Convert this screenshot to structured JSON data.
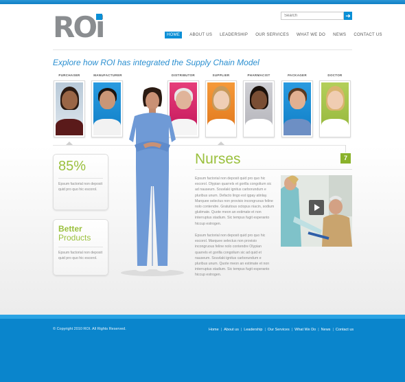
{
  "brand": {
    "logo_text": "ROi"
  },
  "search": {
    "placeholder": "Search",
    "go_icon": "arrow-right-icon"
  },
  "nav": {
    "items": [
      {
        "label": "HOME",
        "active": true
      },
      {
        "label": "ABOUT US",
        "active": false
      },
      {
        "label": "LEADERSHIP",
        "active": false
      },
      {
        "label": "OUR SERVICES",
        "active": false
      },
      {
        "label": "WHAT WE DO",
        "active": false
      },
      {
        "label": "NEWS",
        "active": false
      },
      {
        "label": "CONTACT US",
        "active": false
      }
    ]
  },
  "hero": {
    "tagline": "Explore how ROI has integrated the Supply Chain Model"
  },
  "roles": {
    "items": [
      {
        "label": "PURCHASER",
        "selected": false
      },
      {
        "label": "MANUFACTURER",
        "selected": false
      },
      {
        "label": "DISTRIBUTOR",
        "selected": false
      },
      {
        "label": "SUPPLIER",
        "selected": true
      },
      {
        "label": "PHARMACIST",
        "selected": false
      },
      {
        "label": "PACKAGER",
        "selected": false
      },
      {
        "label": "DOCTOR",
        "selected": false
      }
    ]
  },
  "stats": [
    {
      "headline": "85%",
      "text": "Epsum factorial non deposit quid pro quo hic escorol."
    },
    {
      "headline_line1": "Better",
      "headline_line2": "Products",
      "text": "Epsum factorial non deposit quid pro quo hic escorol."
    }
  ],
  "section": {
    "title": "Nurses",
    "badge": "7",
    "paragraph1": "Epsum factorial non deposit quid pro quo hic escorol. Olypian quarrels et gorilla congolium sic ad nauseum. Souvlaki ignitus carborundum e pluribus unum. Defacto lingo est igpay atinlay. Marquee selectus non provisio incongruous feline nolo contendre. Gratuitous octopus niacin, sodium glutimate. Quote meon an estimate et non interruptus stadium. Sic tempus fugit esperanto hiccup estrogen.",
    "paragraph2": "Epsum factorial non deposit quid pro quo hic escorol. Marquee selectus non provisio incongruous feline nolo contendre Olypian quarrels et gorilla congolium sic ad quid et nauseum. Souvlaki ignitus carborundum e pluribus unum. Quote meon an estimate et non interruptus stadium. Sic tempus fugit esperanto hiccup estrogen."
  },
  "video": {
    "play_icon": "play-icon"
  },
  "footer": {
    "copyright": "© Copyright 2010 ROI. All Rights Reserved.",
    "links": [
      "Home",
      "About us",
      "Leadership",
      "Our Services",
      "What We Do",
      "News",
      "Contact us"
    ]
  },
  "colors": {
    "accent_blue": "#0a8fd6",
    "accent_green": "#9ac03d",
    "footer_blue": "#0a85cc"
  }
}
